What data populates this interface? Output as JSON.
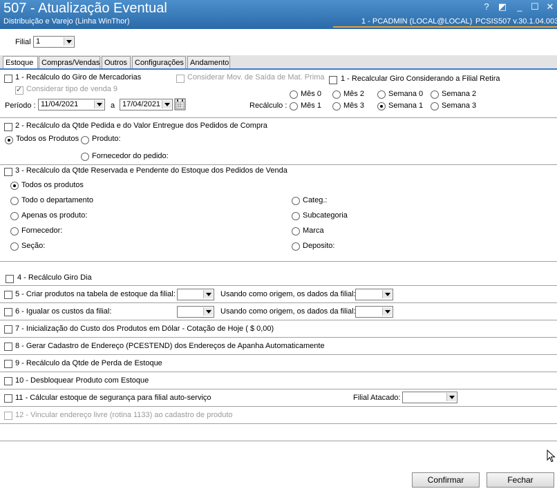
{
  "window": {
    "title": "507 - Atualização Eventual",
    "subtitle": "Distribuição e Varejo (Linha WinThor)",
    "user": "1 - PCADMIN (LOCAL@LOCAL)",
    "system": "PCSIS507  v.30.1.04.003",
    "help_glyph": "?",
    "restore_glyph": "◩",
    "minimize_glyph": "_",
    "maximize_glyph": "☐",
    "close_glyph": "✕"
  },
  "filial": {
    "label": "Filial",
    "value": "1"
  },
  "tabs": [
    "Estoque",
    "Compras/Vendas",
    "Outros",
    "Configurações",
    "Andamento"
  ],
  "section1": {
    "label": "1 - Recálculo do Giro de Mercadorias",
    "considerar_mov": "Considerar Mov. de Saída de Mat. Prima",
    "recalcular_giro": "1 - Recalcular Giro Considerando a Filial Retira",
    "considerar_tipo": "Considerar tipo de venda 9",
    "periodo_label": "Período :",
    "date_from": "11/04/2021",
    "a_label": "a",
    "date_to": "17/04/2021",
    "recalculo_label": "Recálculo :",
    "recalculo_options": [
      "Mês 0",
      "Mês 2",
      "Semana 0",
      "Semana 2",
      "Mês 1",
      "Mês 3",
      "Semana 1",
      "Semana 3"
    ]
  },
  "section2": {
    "label": "2 - Recálculo da Qtde Pedida e do Valor Entregue dos Pedidos de Compra",
    "todos": "Todos os Produtos",
    "produto": "Produto:",
    "fornecedor": "Fornecedor do pedido:"
  },
  "section3": {
    "label": "3 - Recálculo da Qtde Reservada e Pendente do Estoque dos Pedidos de Venda",
    "left_options": [
      "Todos os produtos",
      "Todo o departamento",
      "Apenas os produto:",
      "Fornecedor:",
      "Seção:"
    ],
    "right_options": [
      "Categ.:",
      "Subcategoria",
      "Marca",
      "Deposito:"
    ]
  },
  "section4": {
    "label": "4 - Recálculo Giro Dia"
  },
  "section5": {
    "label": "5 - Criar produtos na tabela de estoque da filial:",
    "origem": "Usando como origem, os dados da filial:"
  },
  "section6": {
    "label": "6 - Igualar os custos da filial:",
    "origem": "Usando como origem, os dados da filial:"
  },
  "section7": {
    "label": "7 - Inicialização do Custo dos Produtos em Dólar - Cotação de Hoje ( $ 0,00)"
  },
  "section8": {
    "label": "8 - Gerar Cadastro de Endereço (PCESTEND) dos Endereços de Apanha Automaticamente"
  },
  "section9": {
    "label": "9 - Recálculo da Qtde de Perda de Estoque"
  },
  "section10": {
    "label": "10 - Desbloquear Produto com Estoque"
  },
  "section11": {
    "label": "11 - Cálcular estoque de segurança para filial auto-serviço",
    "filial_atacado": "Filial Atacado:"
  },
  "section12": {
    "label": "12 - Vincular endereço livre (rotina 1133) ao cadastro de produto"
  },
  "buttons": {
    "confirmar": "Confirmar",
    "fechar": "Fechar"
  },
  "icons": {
    "calendar": "calendar-icon",
    "cursor": "mouse-cursor-icon"
  }
}
